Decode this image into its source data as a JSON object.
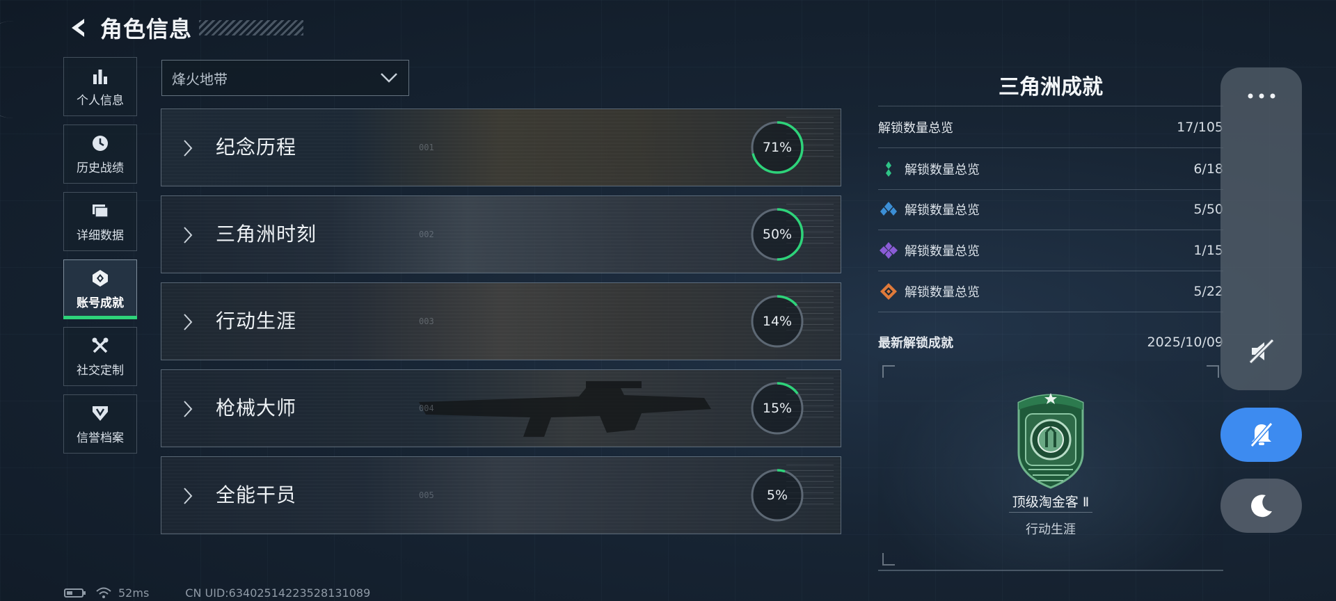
{
  "header": {
    "title": "角色信息",
    "back_icon": "back-arrow-icon"
  },
  "sidebar": {
    "items": [
      {
        "label": "个人信息",
        "icon": "bar-chart-icon",
        "active": false
      },
      {
        "label": "历史战绩",
        "icon": "history-clock-icon",
        "active": false
      },
      {
        "label": "详细数据",
        "icon": "folder-stack-icon",
        "active": false
      },
      {
        "label": "账号成就",
        "icon": "achievement-icon",
        "active": true
      },
      {
        "label": "社交定制",
        "icon": "tools-icon",
        "active": false
      },
      {
        "label": "信誉档案",
        "icon": "credit-shield-icon",
        "active": false
      }
    ]
  },
  "mode_select": {
    "value": "烽火地带"
  },
  "categories": [
    {
      "label": "纪念历程",
      "percent_text": "71%",
      "progress": 0.71,
      "num": "001"
    },
    {
      "label": "三角洲时刻",
      "percent_text": "50%",
      "progress": 0.5,
      "num": "002"
    },
    {
      "label": "行动生涯",
      "percent_text": "14%",
      "progress": 0.14,
      "num": "003"
    },
    {
      "label": "枪械大师",
      "percent_text": "15%",
      "progress": 0.15,
      "num": "004"
    },
    {
      "label": "全能干员",
      "percent_text": "5%",
      "progress": 0.05,
      "num": "005"
    }
  ],
  "right_panel": {
    "title": "三角洲成就",
    "total": {
      "label": "解锁数量总览",
      "value": "17/105"
    },
    "tiers": [
      {
        "label": "解锁数量总览",
        "value": "6/18",
        "color": "#2fc487",
        "icon": "green-diamond-icon"
      },
      {
        "label": "解锁数量总览",
        "value": "5/50",
        "color": "#3c8fd6",
        "icon": "blue-diamond-icon"
      },
      {
        "label": "解锁数量总览",
        "value": "1/15",
        "color": "#8b5cd6",
        "icon": "purple-diamond-icon"
      },
      {
        "label": "解锁数量总览",
        "value": "5/22",
        "color": "#e07a3a",
        "icon": "orange-diamond-icon"
      }
    ],
    "latest": {
      "label": "最新解锁成就",
      "date": "2025/10/09"
    },
    "badge": {
      "name": "顶级淘金客 Ⅱ",
      "category": "行动生涯"
    }
  },
  "system_overlay": {
    "more": "more-dots-icon",
    "mute": "mute-icon",
    "notify_off": "notification-off-icon",
    "night": "night-mode-icon"
  },
  "status": {
    "ping": "52ms",
    "uid": "CN UID:6340251422352813108​9"
  },
  "colors": {
    "accent_green": "#2ed37a",
    "ring_track": "#5d6874",
    "overlay_blue": "#3d8bf0"
  }
}
